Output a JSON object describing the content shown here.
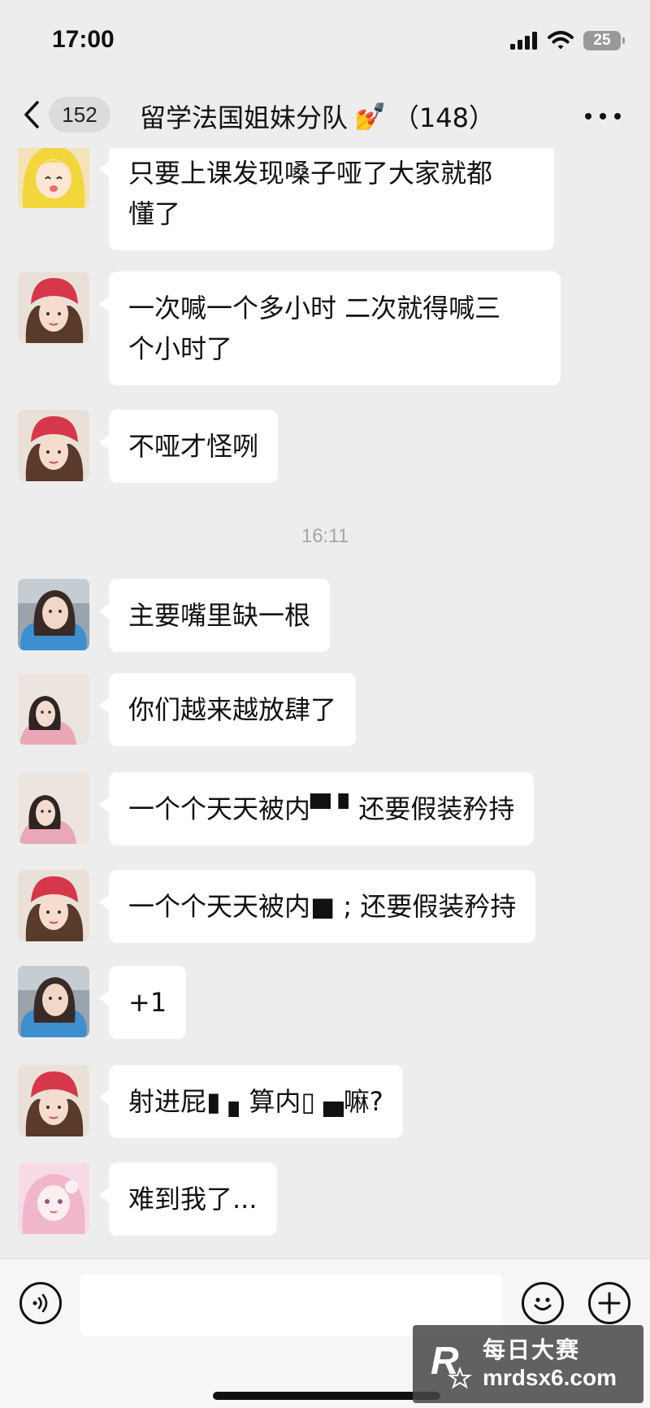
{
  "status_bar": {
    "time": "17:00",
    "battery": "25",
    "icons": [
      "signal-icon",
      "wifi-icon",
      "battery-icon"
    ]
  },
  "nav": {
    "unread_count": "152",
    "title": "留学法国姐妹分队",
    "title_emoji": "💅",
    "member_count": "（148）",
    "back_icon": "chevron-left-icon",
    "more_icon": "more-icon"
  },
  "messages": [
    {
      "avatar": "avatar-anime-yellow",
      "text_lines": [
        "只要上课发现嗓子哑了大家就都",
        "懂了"
      ]
    },
    {
      "avatar": "avatar-girl-red-hat",
      "text_lines": [
        "一次喊一个多小时 二次就得喊三",
        "个小时了"
      ]
    },
    {
      "avatar": "avatar-girl-red-hat",
      "text_lines": [
        "不哑才怪咧"
      ]
    },
    {
      "time_divider": "16:11"
    },
    {
      "avatar": "avatar-girl-car",
      "text_lines": [
        "主要嘴里缺一根"
      ]
    },
    {
      "avatar": "avatar-girl-pink",
      "text_lines": [
        "你们越来越放肆了"
      ]
    },
    {
      "avatar": "avatar-girl-pink",
      "text_lines": [
        "一个个天天被内▀ ▘还要假装矜持"
      ]
    },
    {
      "avatar": "avatar-girl-red-hat",
      "text_lines": [
        "一个个天天被内■ ; 还要假装矜持"
      ]
    },
    {
      "avatar": "avatar-girl-car",
      "text_lines": [
        "+1"
      ]
    },
    {
      "avatar": "avatar-girl-red-hat",
      "text_lines": [
        "射进屁▮ ▖算内▯ ▄嘛?"
      ]
    },
    {
      "avatar": "avatar-anime-pink",
      "text_lines": [
        "难到我了..."
      ]
    }
  ],
  "input_bar": {
    "voice_icon": "voice-icon",
    "input_value": "",
    "emoji_icon": "emoji-icon",
    "plus_icon": "plus-icon"
  },
  "watermark": {
    "logo_letter": "R",
    "line1": "每日大赛",
    "line2": "mrdsx6.com"
  },
  "colors": {
    "background": "#ededed",
    "bubble": "#ffffff",
    "time_divider": "#a6a6a6"
  }
}
